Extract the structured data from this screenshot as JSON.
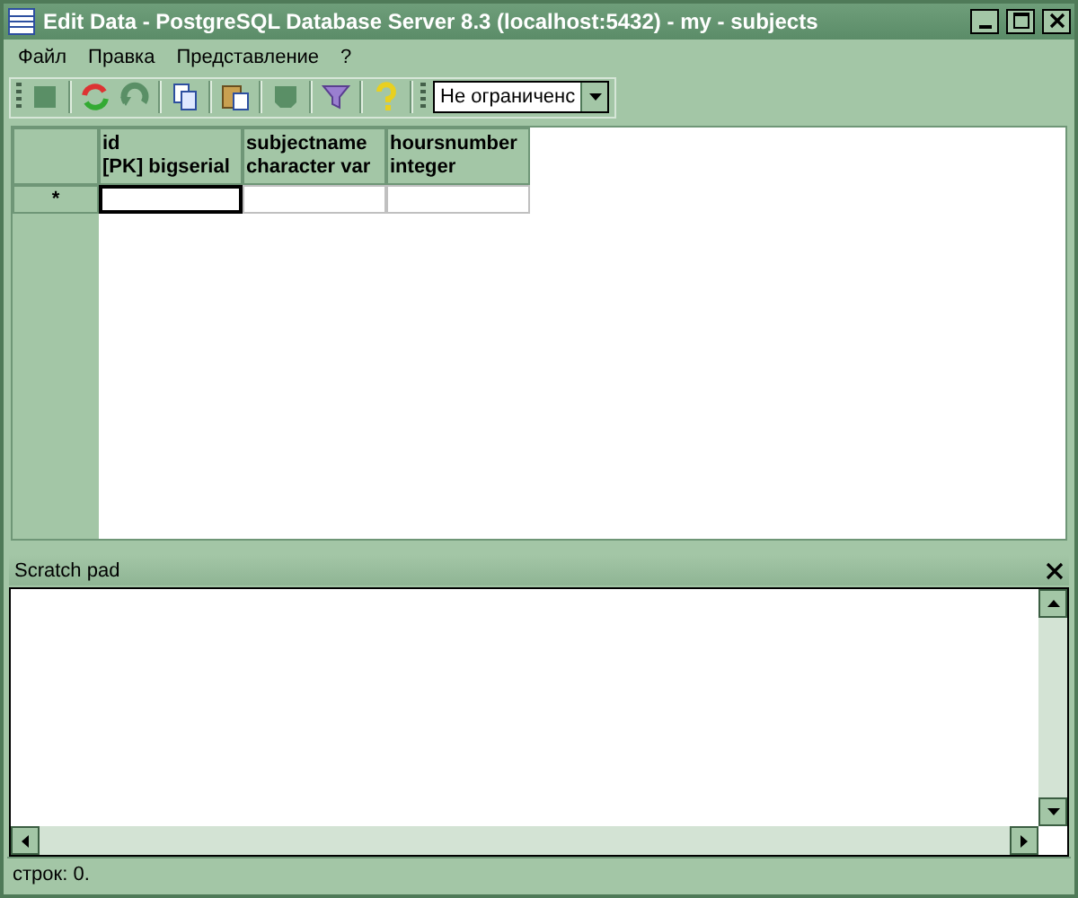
{
  "window": {
    "title": "Edit Data - PostgreSQL Database Server 8.3 (localhost:5432) - my - subjects"
  },
  "menu": [
    "Файл",
    "Правка",
    "Представление",
    "?"
  ],
  "toolbar": {
    "limit_combo": {
      "value": "Не ограниченс"
    }
  },
  "table": {
    "columns": [
      {
        "name": "id",
        "type": "[PK] bigserial"
      },
      {
        "name": "subjectname",
        "type": "character var"
      },
      {
        "name": "hoursnumber",
        "type": "integer"
      }
    ],
    "new_row_marker": "*"
  },
  "scratch_pad": {
    "title": "Scratch pad"
  },
  "status_bar": "строк: 0."
}
